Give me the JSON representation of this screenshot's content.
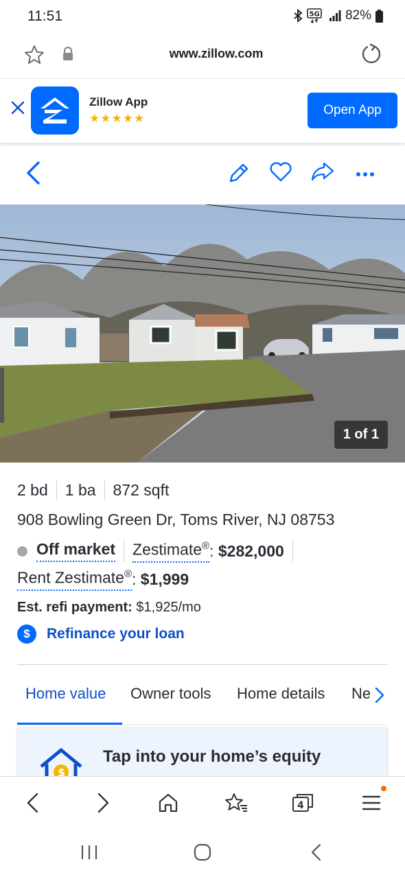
{
  "status_bar": {
    "time": "11:51",
    "battery": "82%"
  },
  "browser": {
    "url": "www.zillow.com"
  },
  "app_banner": {
    "title": "Zillow App",
    "rating_stars": "★★★★★",
    "open_button": "Open App"
  },
  "photo": {
    "counter": "1 of 1"
  },
  "listing": {
    "beds": "2 bd",
    "baths": "1 ba",
    "sqft": "872 sqft",
    "address": "908 Bowling Green Dr, Toms River, NJ 08753",
    "status": "Off market",
    "zestimate_label": "Zestimate",
    "zestimate_suffix": ": ",
    "zestimate_value": "$282,000",
    "rent_label": "Rent Zestimate",
    "rent_value": "$1,999",
    "refi_label": "Est. refi payment:",
    "refi_value": "$1,925/mo",
    "refi_link": "Refinance your loan",
    "refi_icon": "$",
    "registered": "®"
  },
  "tabs": [
    {
      "label": "Home value",
      "active": true
    },
    {
      "label": "Owner tools",
      "active": false
    },
    {
      "label": "Home details",
      "active": false
    },
    {
      "label": "Neighborhood",
      "active": false
    }
  ],
  "equity_card": {
    "title": "Tap into your home’s equity"
  },
  "browser_nav": {
    "tab_count": "4"
  },
  "colors": {
    "brand_blue": "#006aff",
    "link_blue": "#0d4ec9",
    "star_gold": "#f5b400"
  }
}
